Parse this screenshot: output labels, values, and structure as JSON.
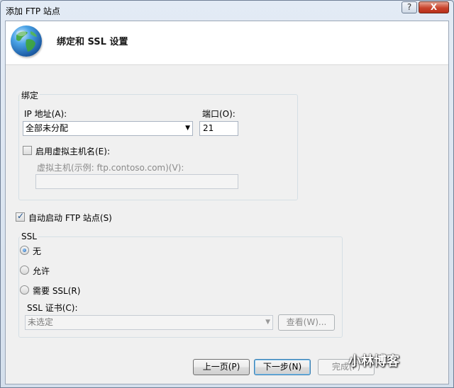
{
  "window": {
    "title": "添加 FTP 站点",
    "help_label": "?",
    "close_label": "X"
  },
  "header": {
    "title": "绑定和 SSL 设置",
    "icon": "globe-icon"
  },
  "binding": {
    "group_label": "绑定",
    "ip_label": "IP 地址(A):",
    "ip_value": "全部未分配",
    "port_label": "端口(O):",
    "port_value": "21",
    "virtual_host_enabled": false,
    "virtual_host_checkbox_label": "启用虚拟主机名(E):",
    "virtual_host_label": "虚拟主机(示例: ftp.contoso.com)(V):",
    "virtual_host_value": ""
  },
  "auto_start": {
    "checked": true,
    "label": "自动启动 FTP 站点(S)"
  },
  "ssl": {
    "group_label": "SSL",
    "options": [
      {
        "label": "无",
        "selected": true
      },
      {
        "label": "允许",
        "selected": false
      },
      {
        "label": "需要 SSL(R)",
        "selected": false
      }
    ],
    "cert_label": "SSL 证书(C):",
    "cert_value": "未选定",
    "view_label": "查看(W)..."
  },
  "footer": {
    "prev_label": "上一页(P)",
    "next_label": "下一步(N)",
    "finish_label": "完成(F)"
  },
  "watermark": {
    "text": "小林博客"
  }
}
